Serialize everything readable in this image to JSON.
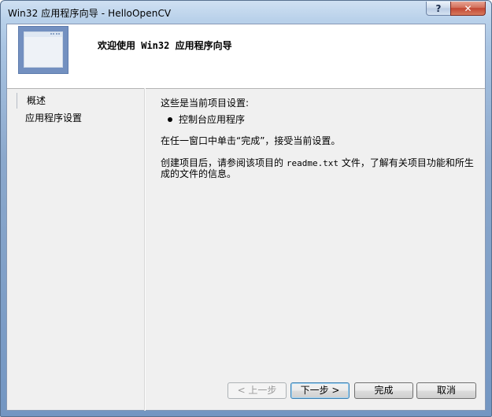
{
  "window": {
    "title": "Win32 应用程序向导 - HelloOpenCV",
    "help_label": "?",
    "close_label": "✕"
  },
  "header": {
    "title": "欢迎使用 Win32 应用程序向导"
  },
  "sidebar": {
    "items": [
      {
        "label": "概述",
        "active": true
      },
      {
        "label": "应用程序设置",
        "active": false
      }
    ]
  },
  "content": {
    "intro": "这些是当前项目设置:",
    "bullet": "控制台应用程序",
    "line2": "在任一窗口中单击“完成”，接受当前设置。",
    "line3_a": "创建项目后，请参阅该项目的 ",
    "line3_file": "readme.txt",
    "line3_b": " 文件，了解有关项目功能和所生",
    "line3_c": "成的文件的信息。"
  },
  "buttons": {
    "prev": "< 上一步",
    "next": "下一步 >",
    "finish": "完成",
    "cancel": "取消"
  }
}
